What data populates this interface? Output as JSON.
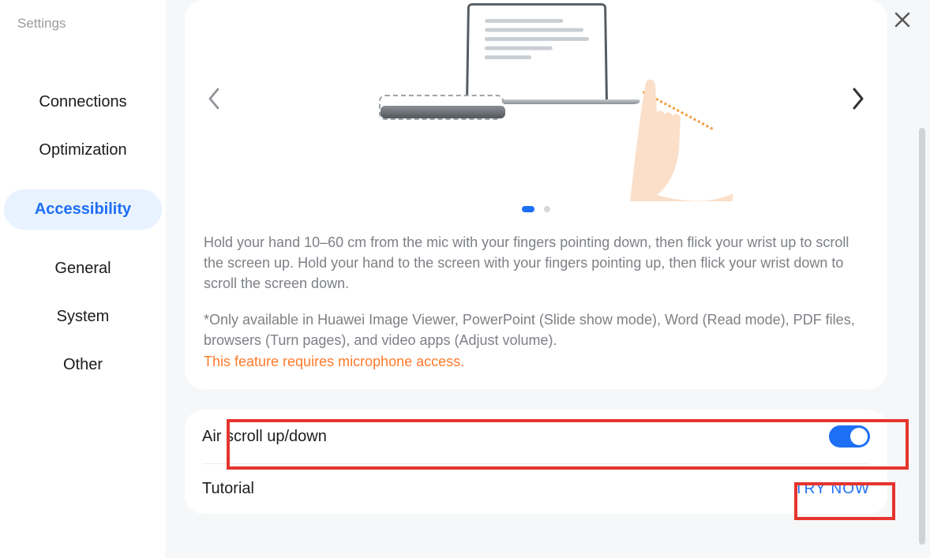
{
  "app": {
    "title": "Settings"
  },
  "sidebar": {
    "items": [
      {
        "label": "Connections"
      },
      {
        "label": "Optimization"
      },
      {
        "label": "Accessibility"
      },
      {
        "label": "General"
      },
      {
        "label": "System"
      },
      {
        "label": "Other"
      }
    ]
  },
  "icons": {
    "close": "close",
    "chev_left": "chevron-left",
    "chev_right": "chevron-right"
  },
  "feature": {
    "description": "Hold your hand 10–60 cm from the mic with your fingers pointing down, then flick your wrist up to scroll the screen up. Hold your hand to the screen with your fingers pointing up, then flick your wrist down to scroll the screen down.",
    "note": "*Only available in Huawei Image Viewer, PowerPoint (Slide show mode), Word (Read mode), PDF files, browsers (Turn pages), and video apps (Adjust volume).",
    "warning": "This feature requires microphone access.",
    "pager": {
      "index": 0,
      "total": 2
    }
  },
  "settings": {
    "air_scroll": {
      "label": "Air scroll up/down",
      "enabled": true
    },
    "tutorial": {
      "label": "Tutorial",
      "action_label": "TRY NOW"
    }
  }
}
